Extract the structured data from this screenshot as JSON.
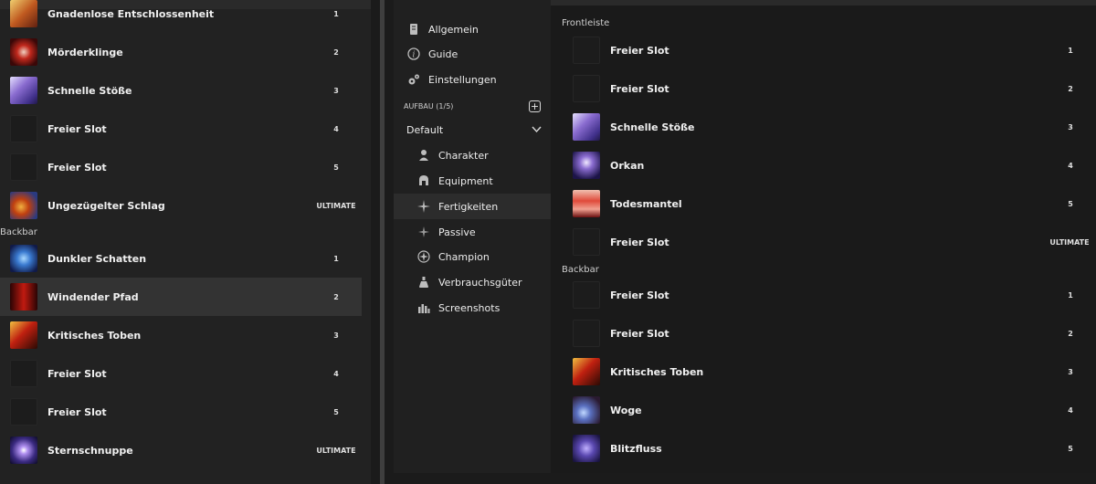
{
  "left": {
    "cut_row": {
      "name": "Gnadenlose Entschlossenheit",
      "slot": "1"
    },
    "front_rows": [
      {
        "name": "Mörderklinge",
        "slot": "2",
        "icon": "moerderklinge-icon"
      },
      {
        "name": "Schnelle Stöße",
        "slot": "3",
        "icon": "schnelle-stoesse-icon"
      },
      {
        "name": "Freier Slot",
        "slot": "4",
        "icon": "empty-slot-icon"
      },
      {
        "name": "Freier Slot",
        "slot": "5",
        "icon": "empty-slot-icon"
      },
      {
        "name": "Ungezügelter Schlag",
        "slot": "ULTIMATE",
        "icon": "ungezuegelter-schlag-icon"
      }
    ],
    "backbar_label": "Backbar",
    "back_rows": [
      {
        "name": "Dunkler Schatten",
        "slot": "1",
        "icon": "dunkler-schatten-icon"
      },
      {
        "name": "Windender Pfad",
        "slot": "2",
        "icon": "windender-pfad-icon"
      },
      {
        "name": "Kritisches Toben",
        "slot": "3",
        "icon": "kritisches-toben-icon"
      },
      {
        "name": "Freier Slot",
        "slot": "4",
        "icon": "empty-slot-icon"
      },
      {
        "name": "Freier Slot",
        "slot": "5",
        "icon": "empty-slot-icon"
      },
      {
        "name": "Sternschnuppe",
        "slot": "ULTIMATE",
        "icon": "sternschnuppe-icon"
      }
    ]
  },
  "nav": {
    "top_items": [
      {
        "label": "Allgemein",
        "icon": "scroll-icon"
      },
      {
        "label": "Guide",
        "icon": "info-icon"
      },
      {
        "label": "Einstellungen",
        "icon": "gears-icon"
      }
    ],
    "build_header": "AUFBAU (1/5)",
    "build_select": "Default",
    "build_items": [
      {
        "label": "Charakter",
        "icon": "character-icon"
      },
      {
        "label": "Equipment",
        "icon": "helmet-icon"
      },
      {
        "label": "Fertigkeiten",
        "icon": "skills-icon"
      },
      {
        "label": "Passive",
        "icon": "passive-icon"
      },
      {
        "label": "Champion",
        "icon": "champion-icon"
      },
      {
        "label": "Verbrauchsgüter",
        "icon": "potion-icon"
      },
      {
        "label": "Screenshots",
        "icon": "screenshots-icon"
      }
    ]
  },
  "right": {
    "frontbar_label": "Frontleiste",
    "front_rows": [
      {
        "name": "Freier Slot",
        "slot": "1",
        "icon": "empty-slot-icon"
      },
      {
        "name": "Freier Slot",
        "slot": "2",
        "icon": "empty-slot-icon"
      },
      {
        "name": "Schnelle Stöße",
        "slot": "3",
        "icon": "schnelle-stoesse-icon"
      },
      {
        "name": "Orkan",
        "slot": "4",
        "icon": "orkan-icon"
      },
      {
        "name": "Todesmantel",
        "slot": "5",
        "icon": "todesmantel-icon"
      },
      {
        "name": "Freier Slot",
        "slot": "ULTIMATE",
        "icon": "empty-slot-icon"
      }
    ],
    "backbar_label": "Backbar",
    "back_rows": [
      {
        "name": "Freier Slot",
        "slot": "1",
        "icon": "empty-slot-icon"
      },
      {
        "name": "Freier Slot",
        "slot": "2",
        "icon": "empty-slot-icon"
      },
      {
        "name": "Kritisches Toben",
        "slot": "3",
        "icon": "kritisches-toben-icon"
      },
      {
        "name": "Woge",
        "slot": "4",
        "icon": "woge-icon"
      },
      {
        "name": "Blitzfluss",
        "slot": "5",
        "icon": "blitzfluss-icon"
      }
    ]
  }
}
